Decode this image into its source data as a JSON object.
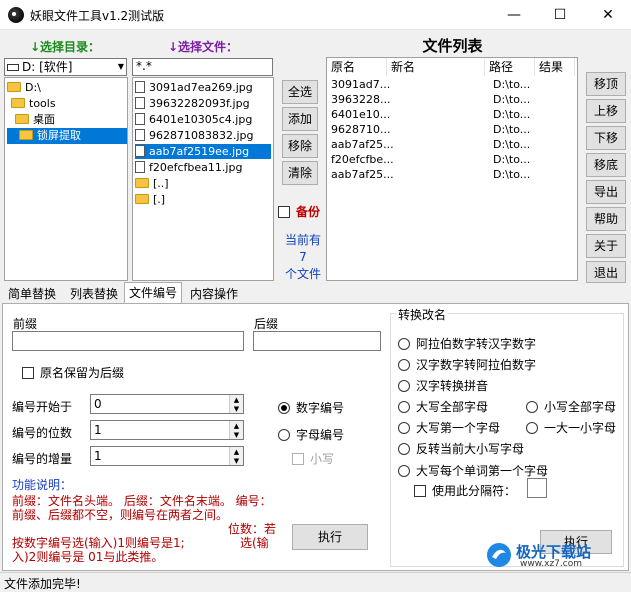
{
  "window": {
    "title": "妖眼文件工具v1.2测试版",
    "minimize": "—",
    "maximize": "☐",
    "close": "✕"
  },
  "left": {
    "dir_label": "↓选择目录：",
    "file_label": "↓选择文件：",
    "drive": "D: [软件]",
    "filter": "*.*",
    "tree": [
      "D:\\",
      "tools",
      "桌面",
      "锁屏提取"
    ],
    "files": [
      "3091ad7ea269.jpg",
      "39632282093f.jpg",
      "6401e10305c4.jpg",
      "962871083832.jpg",
      "aab7af2519ee.jpg",
      "f20efcfbea11.jpg",
      "[..]",
      "[.]"
    ]
  },
  "mid_buttons": {
    "select_all": "全选",
    "add": "添加",
    "remove": "移除",
    "clear": "清除"
  },
  "backup": {
    "label": "备份"
  },
  "count": {
    "line1": "当前有",
    "num": "7",
    "line2": "个文件"
  },
  "file_list": {
    "title": "文件列表",
    "columns": [
      "原名",
      "新名",
      "路径",
      "结果"
    ],
    "rows": [
      {
        "orig": "3091ad7...",
        "path": "D:\\to..."
      },
      {
        "orig": "3963228...",
        "path": "D:\\to..."
      },
      {
        "orig": "6401e10...",
        "path": "D:\\to..."
      },
      {
        "orig": "9628710...",
        "path": "D:\\to..."
      },
      {
        "orig": "aab7af25...",
        "path": "D:\\to..."
      },
      {
        "orig": "f20efcfbe...",
        "path": "D:\\to..."
      },
      {
        "orig": "aab7af25...",
        "path": "D:\\to..."
      }
    ]
  },
  "right_buttons": {
    "top": "移顶",
    "up": "上移",
    "down": "下移",
    "bottom": "移底",
    "export": "导出",
    "help": "帮助",
    "about": "关于",
    "exit": "退出"
  },
  "tabs": [
    "简单替换",
    "列表替换",
    "文件编号",
    "内容操作"
  ],
  "numbering": {
    "prefix_label": "前缀",
    "suffix_label": "后缀",
    "keep_name": "原名保留为后缀",
    "start_label": "编号开始于",
    "start_value": "0",
    "digits_label": "编号的位数",
    "digits_value": "1",
    "increment_label": "编号的增量",
    "increment_value": "1",
    "numeric": "数字编号",
    "alpha": "字母编号",
    "lowercase": "小写",
    "help_title": "功能说明：",
    "help_text_1": "前缀：文件名头端。  后缀：文件名末端。  编号：前缀、后缀都不空，则编号在两者之间。",
    "help_text_2": "位数：若",
    "help_text_3": "按数字编号选(输入)1则编号是1;",
    "help_text_4": "选(输",
    "help_text_5": "入)2则编号是 01与此类推。",
    "execute": "执行"
  },
  "convert": {
    "title": "转换改名",
    "options": [
      "阿拉伯数字转汉字数字",
      "汉字数字转阿拉伯数字",
      "汉字转换拼音",
      "大写全部字母",
      "小写全部字母",
      "大写第一个字母",
      "一大一小字母",
      "反转当前大小写字母",
      "大写每个单词第一个字母"
    ],
    "separator": "使用此分隔符：",
    "execute": "执行"
  },
  "status": "文件添加完毕!",
  "watermark": {
    "brand": "极光下载站",
    "url": "www.xz7.com"
  }
}
